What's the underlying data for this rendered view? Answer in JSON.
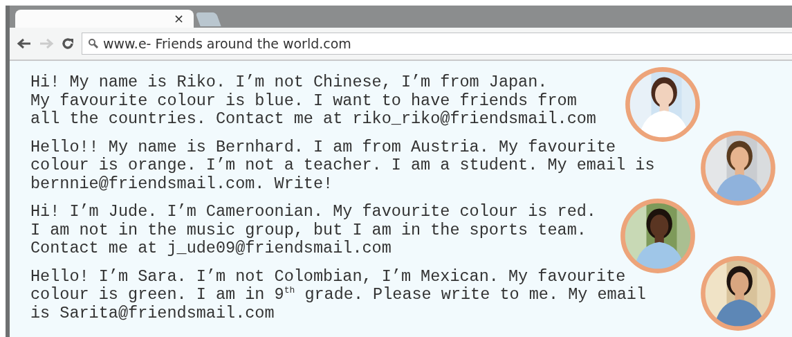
{
  "browser": {
    "tabs": [
      {
        "close": "×",
        "selected": true
      },
      {
        "selected": false
      }
    ],
    "address_bar": {
      "value": "www.e- Friends around the world.com"
    }
  },
  "posts": [
    {
      "lines": [
        "Hi! My name is Riko. I’m not Chinese, I’m from Japan.",
        "My favourite colour is blue. I want to have friends from",
        "all the countries. Contact me at riko_riko@friendsmail.com"
      ],
      "photo": {
        "kind": "picture"
      }
    },
    {
      "lines": [
        "Hello!! My name is Bernhard. I am from Austria. My favourite",
        "colour is orange. I’m not a teacher. I am a student. My email is",
        "bernnie@friendsmail.com. Write!"
      ],
      "photo": {
        "kind": "picture"
      }
    },
    {
      "lines": [
        "Hi! I’m Jude. I’m Cameroonian. My favourite colour is red.",
        "I am not in the music group, but I am in the sports team.",
        "Contact me at j_ude09@friendsmail.com"
      ],
      "photo": {
        "kind": "picture"
      }
    },
    {
      "lines": [
        "Hello! I’m Sara. I’m not Colombian, I’m Mexican. My favourite",
        "colour is green. I am in 9$^{th}$ grade. Please write to me. My email",
        "is Sarita@friendsmail.com"
      ],
      "photo": {
        "kind": "picture"
      }
    }
  ]
}
